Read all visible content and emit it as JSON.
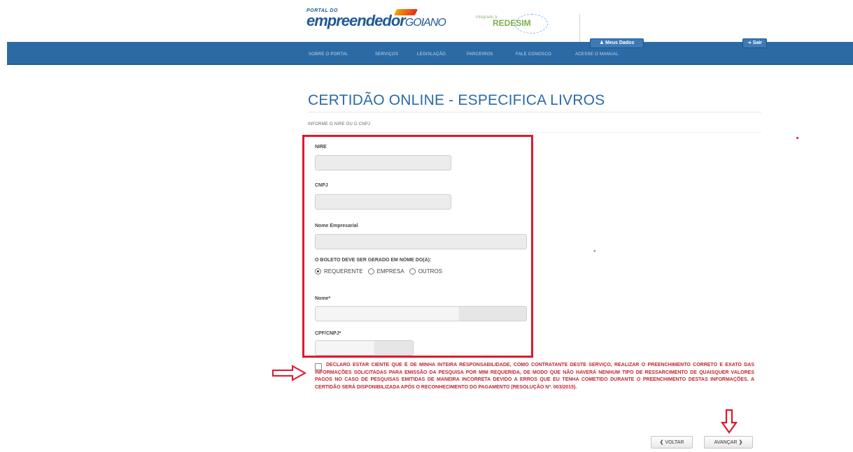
{
  "header": {
    "logo_small": "PORTAL DO",
    "logo_big": "empreendedor",
    "logo_big_suffix": "GOIANO",
    "partner_logo_small": "Integrado à",
    "partner_logo": "REDESIM"
  },
  "user_bar": {
    "my_data_label": "Meus Dados",
    "logout_label": "Sair"
  },
  "nav": {
    "items": [
      {
        "label": "SOBRE O PORTAL"
      },
      {
        "label": "SERVIÇOS"
      },
      {
        "label": "LEGISLAÇÃO"
      },
      {
        "label": "PARCEIROS"
      },
      {
        "label": "FALE CONOSCO"
      },
      {
        "label": "ACESSE O MANUAL"
      }
    ]
  },
  "page": {
    "title": "CERTIDÃO ONLINE - ESPECIFICA LIVROS",
    "subtitle": "INFORME O NIRE OU O CNPJ"
  },
  "form": {
    "nire_label": "NIRE",
    "nire_value": "",
    "cnpj_label": "CNPJ",
    "cnpj_value": "",
    "nome_empresarial_label": "Nome Empresarial",
    "nome_empresarial_value": "",
    "boleto_label": "O BOLETO DEVE SER GERADO EM NOME DO(A):",
    "boleto_options": [
      {
        "label": "REQUERENTE",
        "selected": true
      },
      {
        "label": "EMPRESA",
        "selected": false
      },
      {
        "label": "OUTROS",
        "selected": false
      }
    ],
    "nome_label": "Nome*",
    "nome_value": "",
    "cpf_label": "CPF/CNPJ*",
    "cpf_value": ""
  },
  "declaration": {
    "checked": false,
    "text": "DECLARO ESTAR CIENTE QUE É DE MINHA INTEIRA RESPONSABILIDADE, COMO CONTRATANTE DESTE SERVIÇO, REALIZAR O PREENCHIMENTO CORRETO E EXATO DAS INFORMAÇÕES SOLICITADAS PARA EMISSÃO DA PESQUISA POR MIM REQUERIDA, DE MODO QUE NÃO HAVERÁ NENHUM TIPO DE RESSARCIMENTO DE QUAISQUER VALORES PAGOS NO CASO DE PESQUISAS EMITIDAS DE MANEIRA INCORRETA DEVIDO A ERROS QUE EU TENHA COMETIDO DURANTE O PREENCHIMENTO DESTAS INFORMAÇÕES. A CERTIDÃO SERÁ DISPONIBILIZADA APÓS O RECONHECIMENTO DO PAGAMENTO (RESOLUÇÃO Nº. 003/2015)."
  },
  "actions": {
    "back_label": "VOLTAR",
    "next_label": "AVANÇAR"
  },
  "colors": {
    "nav_blue": "#2c6aa5",
    "highlight_red": "#e0182d",
    "declaration_red": "#c4232f"
  }
}
